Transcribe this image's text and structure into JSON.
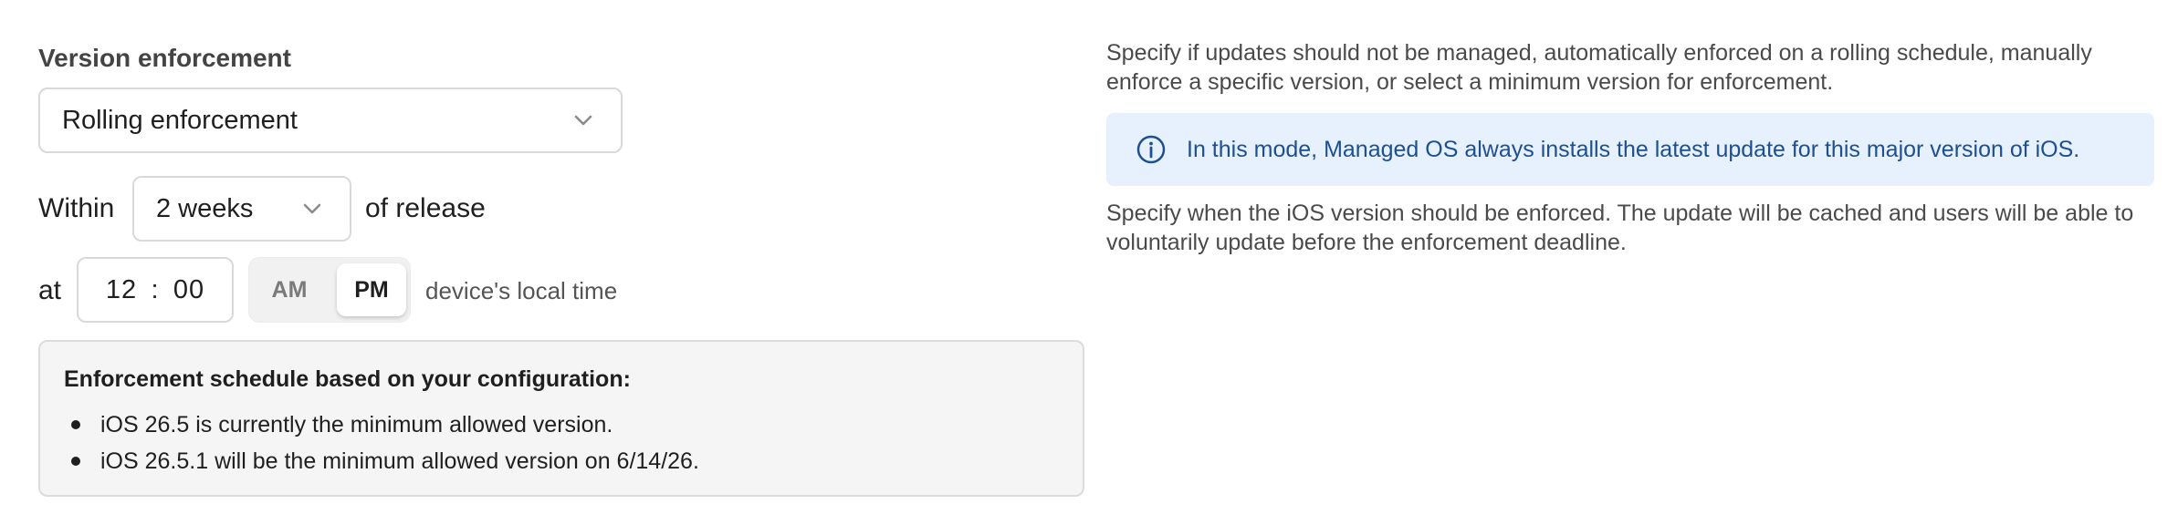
{
  "version_enforcement": {
    "label": "Version enforcement",
    "mode_select": {
      "value": "Rolling enforcement",
      "icon": "chevron-down-icon"
    }
  },
  "deadline": {
    "within_label": "Within",
    "duration_select": {
      "value": "2 weeks",
      "icon": "chevron-down-icon"
    },
    "after_label": "of release"
  },
  "time": {
    "at_label": "at",
    "hour": "12",
    "separator": ":",
    "minute": "00",
    "am_label": "AM",
    "pm_label": "PM",
    "selected_period": "PM",
    "suffix": "device's local time"
  },
  "schedule": {
    "title": "Enforcement schedule based on your configuration:",
    "items": [
      "iOS 26.5 is currently the minimum allowed version.",
      "iOS 26.5.1 will be the minimum allowed version on 6/14/26."
    ]
  },
  "help": {
    "mode_description": "Specify if updates should not be managed, automatically enforced on a rolling schedule, manually enforce a specific version, or select a minimum version for enforcement.",
    "info_banner": {
      "icon": "info-icon",
      "text": "In this mode, Managed OS always installs the latest update for this major version of iOS."
    },
    "deadline_description": "Specify when the iOS version should be enforced. The update will be cached and users will be able to voluntarily update before the enforcement deadline."
  },
  "colors": {
    "info_banner_bg": "#e6f1fd",
    "info_text": "#1d4f91",
    "schedule_bg": "#f5f5f5",
    "border": "#d9d9d9"
  }
}
